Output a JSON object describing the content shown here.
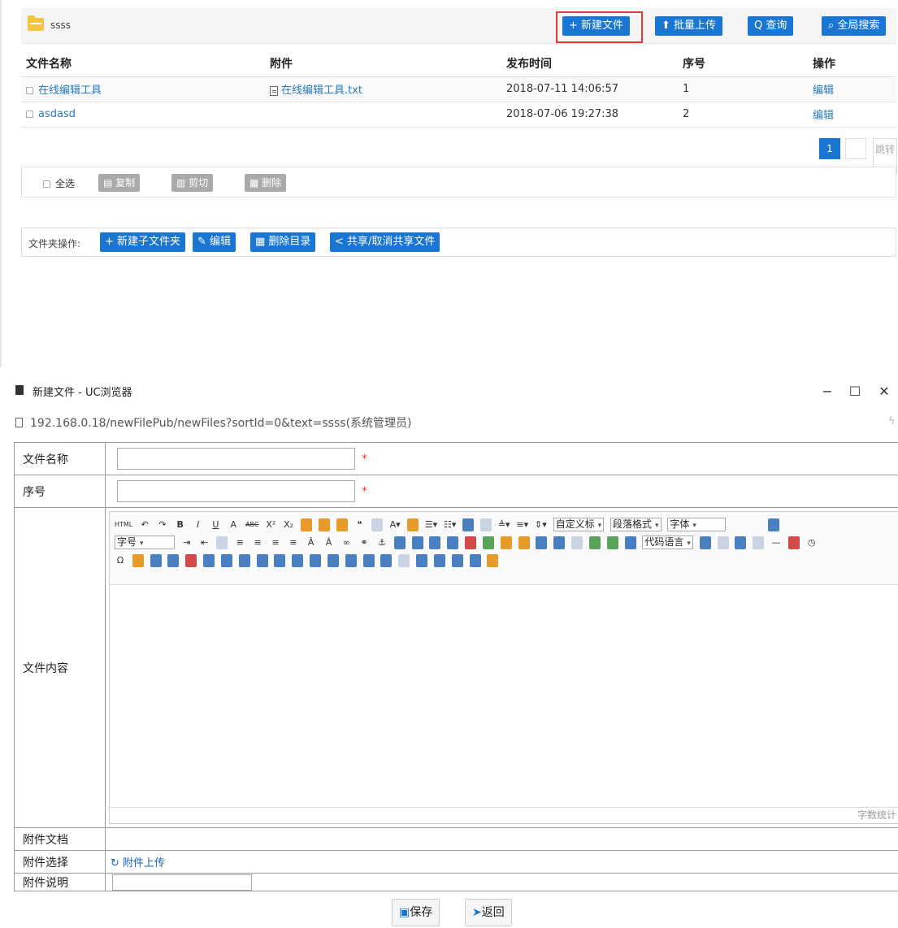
{
  "header": {
    "folder_name": "ssss"
  },
  "toolbar": {
    "new_file": "+ 新建文件",
    "batch_upload": "⬆ 批量上传",
    "query": "Q 查询",
    "global_search": "全局搜索"
  },
  "table": {
    "columns": [
      "文件名称",
      "附件",
      "发布时间",
      "序号",
      "操作"
    ],
    "rows": [
      {
        "name": "在线编辑工具",
        "attachment": "在线编辑工具.txt",
        "time": "2018-07-11 14:06:57",
        "seq": "1",
        "action": "编辑"
      },
      {
        "name": "asdasd",
        "attachment": "",
        "time": "2018-07-06 19:27:38",
        "seq": "2",
        "action": "编辑"
      }
    ]
  },
  "pagination": {
    "current": "1",
    "jump_label": "跳转"
  },
  "bulk": {
    "select_all": "全选",
    "copy": "复制",
    "cut": "剪切",
    "delete": "删除"
  },
  "folder_ops": {
    "label": "文件夹操作:",
    "new_subfolder": "+ 新建子文件夹",
    "edit": "编辑",
    "delete_dir": "删除目录",
    "share": "共享/取消共享文件"
  },
  "window": {
    "title": "新建文件 - UC浏览器",
    "url": "192.168.0.18/newFilePub/newFiles?sortId=0&text=ssss(系统管理员)"
  },
  "form": {
    "file_name_label": "文件名称",
    "seq_label": "序号",
    "content_label": "文件内容",
    "attach_doc_label": "附件文档",
    "attach_select_label": "附件选择",
    "attach_upload": "附件上传",
    "attach_note_label": "附件说明",
    "required_mark": "*",
    "word_count": "字数统计",
    "editor_selects": {
      "custom_title": "自定义标",
      "paragraph": "段落格式",
      "font": "字体",
      "font_size": "字号",
      "code_lang": "代码语言"
    }
  },
  "actions": {
    "save": "保存",
    "back": "返回"
  },
  "colors": {
    "primary": "#1976d2",
    "highlight_border": "#e53935",
    "link": "#2a7ab8",
    "disabled_btn": "#aaaaaa"
  }
}
